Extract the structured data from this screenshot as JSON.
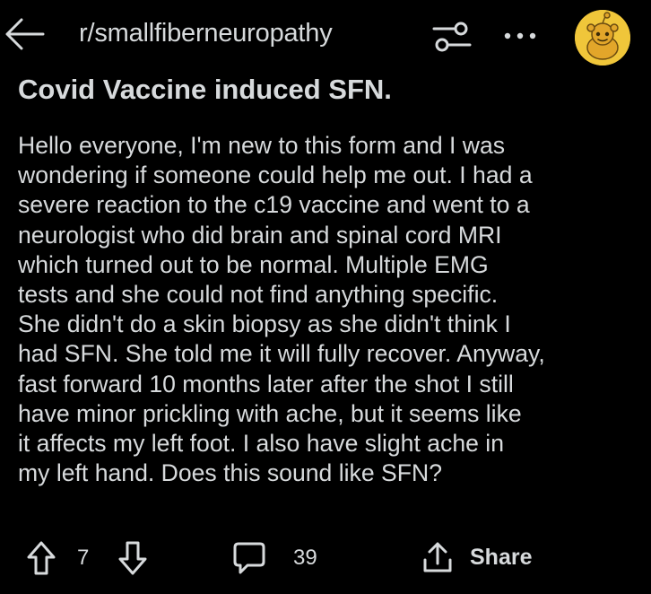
{
  "header": {
    "subreddit": "r/smallfiberneuropathy",
    "back_icon": "arrow-left-icon",
    "filter_icon": "sliders-icon",
    "more_icon": "more-dots-icon",
    "avatar_icon": "reddit-snoo-avatar",
    "avatar_color": "#f0c63a"
  },
  "post": {
    "title": "Covid Vaccine induced SFN.",
    "body_lines": [
      "Hello everyone, I'm new to this form and I was",
      "wondering if someone could help me out. I had a",
      "severe reaction to the c19 vaccine and went to a",
      "neurologist who did brain and spinal cord MRI",
      "which turned out to be normal. Multiple EMG",
      "tests and she could not find anything specific.",
      "She didn't do a skin biopsy as she didn't think I",
      "had SFN. She told me it will fully recover. Anyway,",
      "fast forward 10 months later after the shot I still",
      "have minor prickling with ache, but it seems like",
      "it affects my left foot. I also have slight ache in",
      "my left hand. Does this sound like SFN?"
    ]
  },
  "actions": {
    "upvote_icon": "upvote-arrow-icon",
    "vote_count": "7",
    "downvote_icon": "downvote-arrow-icon",
    "comment_icon": "comment-bubble-icon",
    "comment_count": "39",
    "share_icon": "share-icon",
    "share_label": "Share"
  },
  "colors": {
    "background": "#000000",
    "text": "#d7dadc"
  }
}
